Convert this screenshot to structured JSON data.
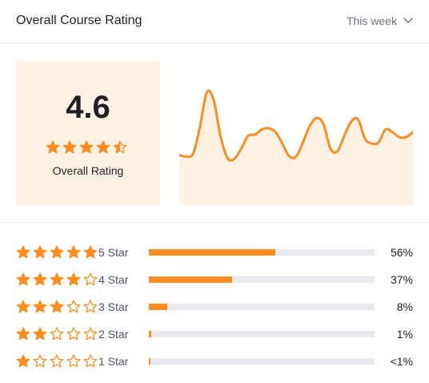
{
  "header": {
    "title": "Overall Course Rating",
    "period_label": "This week"
  },
  "summary": {
    "score": "4.6",
    "label": "Overall Rating",
    "star_fill": [
      1,
      1,
      1,
      1,
      0.5
    ]
  },
  "trend_chart": {
    "type": "area",
    "x_start": 0,
    "x_end": 100,
    "values": [
      39,
      38,
      40,
      61,
      88,
      82,
      54,
      37,
      36,
      44,
      54,
      55,
      59,
      60,
      57,
      48,
      38,
      38,
      49,
      62,
      68,
      63,
      44,
      42,
      54,
      65,
      67,
      52,
      48,
      49,
      59,
      57,
      53,
      53,
      57
    ],
    "ylim": [
      0,
      100
    ]
  },
  "breakdown": [
    {
      "stars": 5,
      "label": "5 Star",
      "percent_text": "56%",
      "value": 56
    },
    {
      "stars": 4,
      "label": "4 Star",
      "percent_text": "37%",
      "value": 37
    },
    {
      "stars": 3,
      "label": "3 Star",
      "percent_text": "8%",
      "value": 8
    },
    {
      "stars": 2,
      "label": "2 Star",
      "percent_text": "1%",
      "value": 1
    },
    {
      "stars": 1,
      "label": "1 Star",
      "percent_text": "<1%",
      "value": 0.7
    }
  ],
  "colors": {
    "accent": "#fd8e1f",
    "summary_bg": "#fff2e5",
    "trend_fill": "#fff2e5",
    "track": "#e9eaf0"
  },
  "icons": {
    "period_toggle": "chevron-down-icon",
    "full_star": "star-filled-icon",
    "half_star": "star-half-icon",
    "empty_star": "star-outline-icon"
  }
}
